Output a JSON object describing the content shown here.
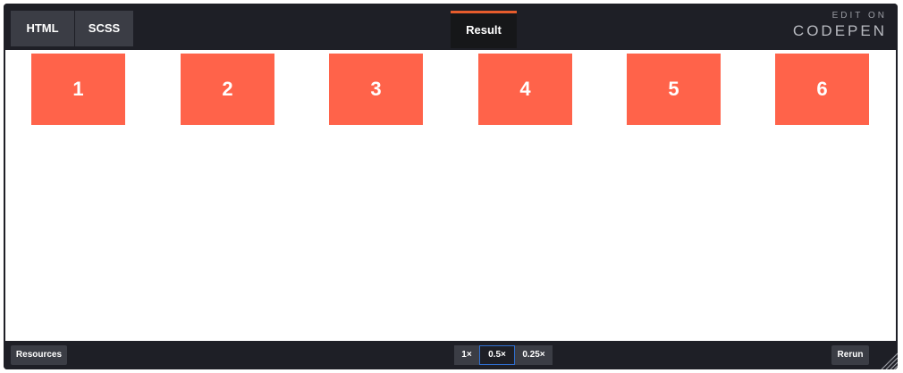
{
  "tabs": {
    "html": "HTML",
    "scss": "SCSS",
    "result": "Result"
  },
  "brand": {
    "edit_on": "EDIT ON",
    "logo": "CODEPEN"
  },
  "result": {
    "boxes": [
      "1",
      "2",
      "3",
      "4",
      "5",
      "6"
    ]
  },
  "footer": {
    "resources": "Resources",
    "zoom": [
      "1×",
      "0.5×",
      "0.25×"
    ],
    "rerun": "Rerun"
  },
  "colors": {
    "box": "#ff634a",
    "bar": "#1e1f26",
    "tab": "#3b3d45",
    "accent": "#e65c2c",
    "zoom_active_border": "#2f6fd1"
  }
}
